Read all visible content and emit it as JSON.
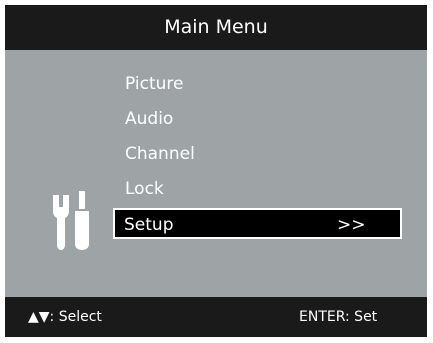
{
  "header": {
    "title": "Main Menu"
  },
  "menu": {
    "items": [
      {
        "label": "Picture",
        "selected": false
      },
      {
        "label": "Audio",
        "selected": false
      },
      {
        "label": "Channel",
        "selected": false
      },
      {
        "label": "Lock",
        "selected": false
      },
      {
        "label": "Setup",
        "selected": true,
        "arrow": ">>"
      }
    ],
    "icon": "tools-icon"
  },
  "footer": {
    "select_hint": "▲▼: Select",
    "enter_hint": "ENTER: Set"
  },
  "colors": {
    "bar_background": "#1a1a1a",
    "panel_background": "#9ea4a5",
    "text": "#ffffff",
    "highlight_background": "#000000",
    "highlight_border": "#ffffff"
  }
}
